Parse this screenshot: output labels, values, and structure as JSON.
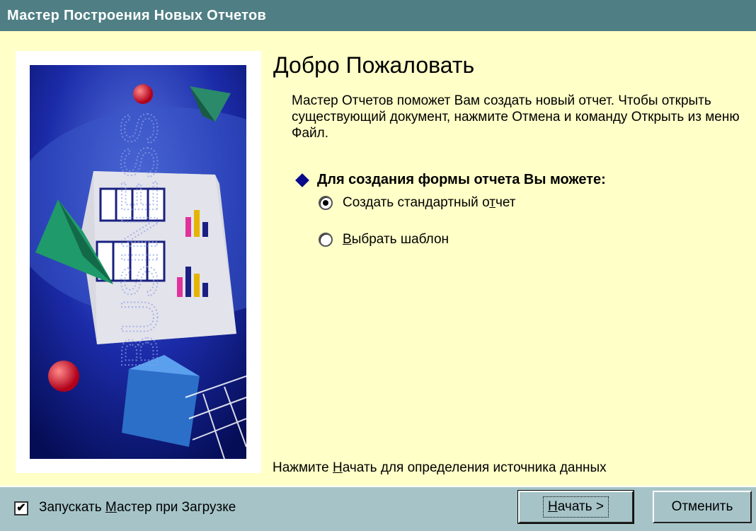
{
  "window": {
    "title": "Мастер Построения Новых Отчетов"
  },
  "content": {
    "heading": "Добро Пожаловать",
    "intro": "Мастер Отчетов поможет Вам создать новый отчет. Чтобы открыть существующий документ, нажмите Отмена и команду Открыть из меню Файл.",
    "choice_title": "Для создания формы отчета Вы можете:",
    "options": [
      {
        "label_pre": "Создать стандартный о",
        "label_u": "т",
        "label_post": "чет",
        "selected": true
      },
      {
        "label_pre": "",
        "label_u": "В",
        "label_post": "ыбрать шаблон",
        "selected": false
      }
    ],
    "footer_pre": "Нажмите ",
    "footer_u": "Н",
    "footer_post": "ачать для определения источника данных"
  },
  "bottom": {
    "checkbox_checked": true,
    "checkbox_pre": "Запускать ",
    "checkbox_u": "М",
    "checkbox_post": "астер при Загрузке",
    "start_u": "Н",
    "start_post": "ачать >",
    "cancel_label": "Отменить"
  },
  "colors": {
    "background": "#ffffc8",
    "titlebar": "#4f7f84",
    "bottombar": "#a6c4c8",
    "diamond": "#0a0a8a"
  },
  "icons": {
    "illustration": "business-reports-illustration",
    "bullet": "diamond-bullet-icon"
  }
}
